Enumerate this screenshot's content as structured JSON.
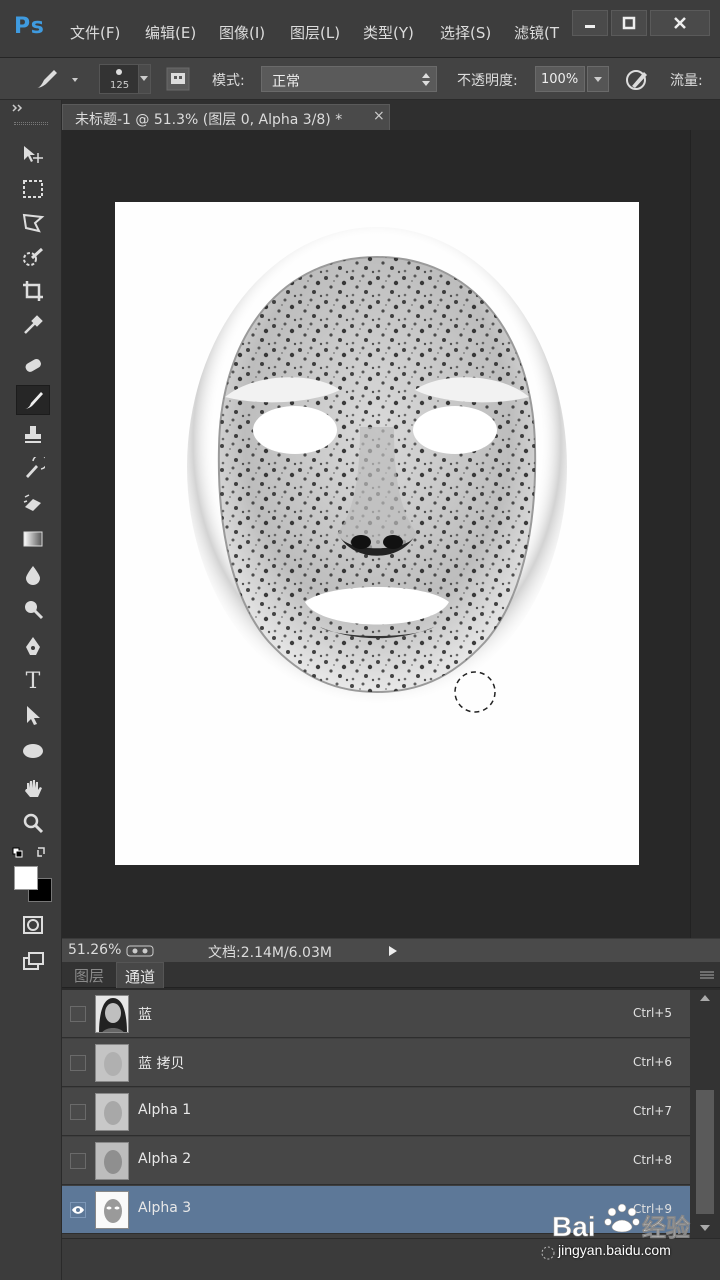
{
  "app": {
    "logo": "Ps"
  },
  "menu": {
    "items": [
      "文件(F)",
      "编辑(E)",
      "图像(I)",
      "图层(L)",
      "类型(Y)",
      "选择(S)",
      "滤镜(T"
    ]
  },
  "options": {
    "brush_size": "125",
    "mode_label": "模式:",
    "mode_value": "正常",
    "opacity_label": "不透明度:",
    "opacity_value": "100%",
    "flow_label": "流量:"
  },
  "document": {
    "tab_title": "未标题-1 @ 51.3% (图层 0, Alpha 3/8) *",
    "close": "×"
  },
  "status": {
    "zoom": "51.26%",
    "doc_info": "文档:2.14M/6.03M"
  },
  "panel": {
    "tabs": [
      "图层",
      "通道"
    ],
    "active_tab": "通道",
    "channels": [
      {
        "name": "蓝",
        "shortcut": "Ctrl+5",
        "visible": false,
        "selected": false
      },
      {
        "name": "蓝 拷贝",
        "shortcut": "Ctrl+6",
        "visible": false,
        "selected": false
      },
      {
        "name": "Alpha 1",
        "shortcut": "Ctrl+7",
        "visible": false,
        "selected": false
      },
      {
        "name": "Alpha 2",
        "shortcut": "Ctrl+8",
        "visible": false,
        "selected": false
      },
      {
        "name": "Alpha 3",
        "shortcut": "Ctrl+9",
        "visible": true,
        "selected": true
      }
    ]
  },
  "watermark": {
    "brand": "Bai",
    "brand2": "经验",
    "url": "jingyan.baidu.com"
  },
  "colors": {
    "accent": "#3f9be0",
    "selection": "#5d7898",
    "panel": "#474747",
    "canvas_bg": "#282828"
  }
}
